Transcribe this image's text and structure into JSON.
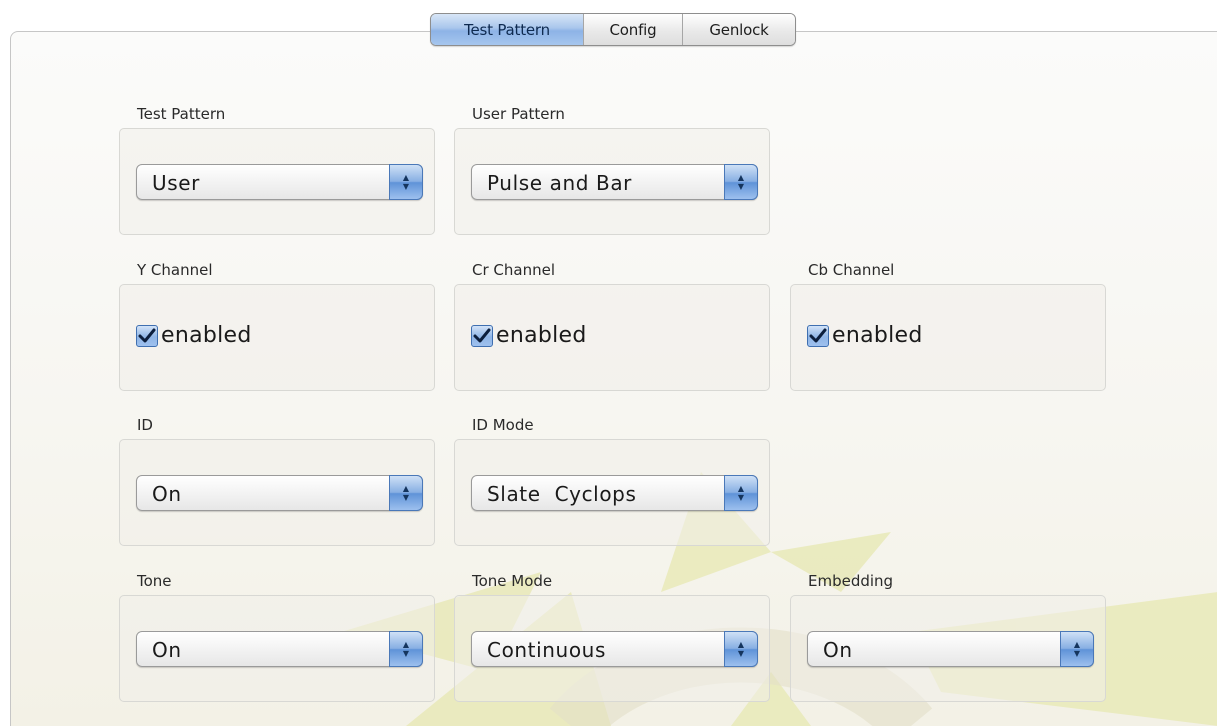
{
  "tabs": [
    {
      "label": "Test Pattern",
      "active": true
    },
    {
      "label": "Config",
      "active": false
    },
    {
      "label": "Genlock",
      "active": false
    }
  ],
  "groups": {
    "test_pattern": {
      "label": "Test Pattern",
      "value": "User"
    },
    "user_pattern": {
      "label": "User Pattern",
      "value": "Pulse and Bar"
    },
    "y_channel": {
      "label": "Y Channel",
      "checkbox_label": "enabled",
      "checked": true
    },
    "cr_channel": {
      "label": "Cr Channel",
      "checkbox_label": "enabled",
      "checked": true
    },
    "cb_channel": {
      "label": "Cb Channel",
      "checkbox_label": "enabled",
      "checked": true
    },
    "id": {
      "label": "ID",
      "value": "On"
    },
    "id_mode": {
      "label": "ID Mode",
      "value": "Slate  Cyclops"
    },
    "tone": {
      "label": "Tone",
      "value": "On"
    },
    "tone_mode": {
      "label": "Tone Mode",
      "value": "Continuous"
    },
    "embedding": {
      "label": "Embedding",
      "value": "On"
    }
  },
  "icons": {
    "popup_arrows": "up-down-arrows-icon",
    "check": "checkmark-icon",
    "watermark": "sunburst-logo"
  },
  "colors": {
    "accent_blue": "#8db3e6",
    "watermark": "#e6e6a8"
  }
}
